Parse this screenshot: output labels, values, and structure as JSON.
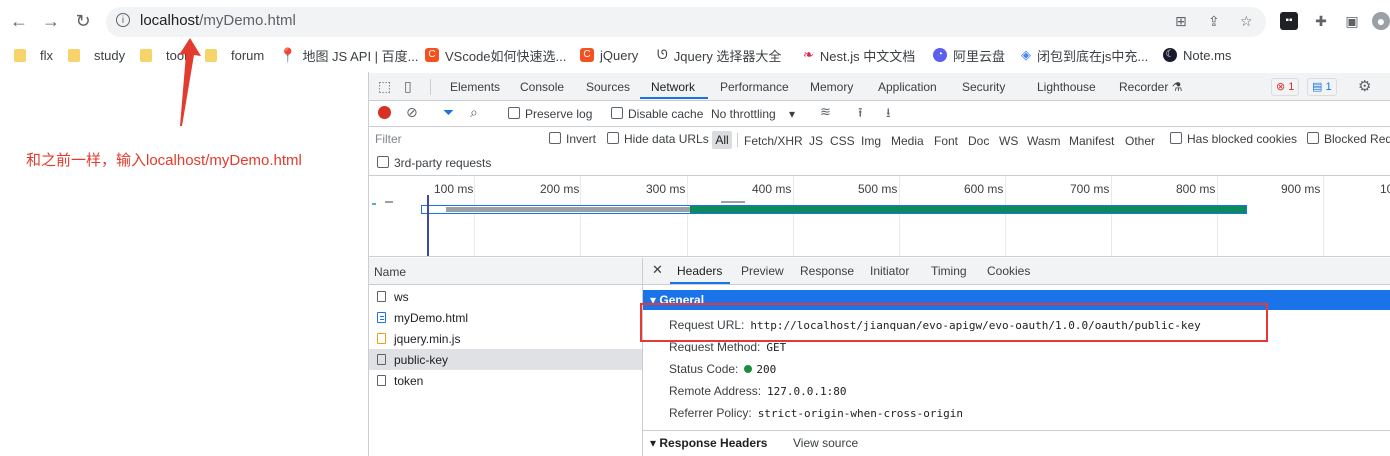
{
  "browser": {
    "url_host": "localhost",
    "url_path": "/myDemo.html"
  },
  "bookmarks": [
    {
      "label": "flx",
      "icon": "folder-icon"
    },
    {
      "label": "study",
      "icon": "folder-icon"
    },
    {
      "label": "tool",
      "icon": "folder-icon"
    },
    {
      "label": "forum",
      "icon": "folder-icon"
    },
    {
      "label": "地图 JS API | 百度...",
      "icon": "map-pin-icon"
    },
    {
      "label": "VScode如何快速选...",
      "icon": "c-icon"
    },
    {
      "label": "jQuery",
      "icon": "c-icon"
    },
    {
      "label": "Jquery 选择器大全",
      "icon": "squiggle-icon"
    },
    {
      "label": "Nest.js 中文文档",
      "icon": "nest-icon"
    },
    {
      "label": "阿里云盘",
      "icon": "cloud-icon"
    },
    {
      "label": "闭包到底在js中充...",
      "icon": "diamond-icon"
    },
    {
      "label": "Note.ms",
      "icon": "moon-icon"
    }
  ],
  "annotation": "和之前一样，输入localhost/myDemo.html",
  "devtools": {
    "tabs": [
      "Elements",
      "Console",
      "Sources",
      "Network",
      "Performance",
      "Memory",
      "Application",
      "Security",
      "Lighthouse",
      "Recorder"
    ],
    "active_tab": "Network",
    "error_count": "1",
    "message_count": "1",
    "toolbar": {
      "preserve_log": "Preserve log",
      "disable_cache": "Disable cache",
      "throttling": "No throttling"
    },
    "filter": {
      "placeholder": "Filter",
      "invert": "Invert",
      "hide_data_urls": "Hide data URLs",
      "types": [
        "All",
        "Fetch/XHR",
        "JS",
        "CSS",
        "Img",
        "Media",
        "Font",
        "Doc",
        "WS",
        "Wasm",
        "Manifest",
        "Other"
      ],
      "blocked_cookies": "Has blocked cookies",
      "blocked_requests": "Blocked Req",
      "third_party": "3rd-party requests"
    },
    "timeline_ticks": [
      "100 ms",
      "200 ms",
      "300 ms",
      "400 ms",
      "500 ms",
      "600 ms",
      "700 ms",
      "800 ms",
      "900 ms",
      "10"
    ],
    "name_header": "Name",
    "requests": [
      {
        "name": "ws",
        "type": "other"
      },
      {
        "name": "myDemo.html",
        "type": "doc"
      },
      {
        "name": "jquery.min.js",
        "type": "js"
      },
      {
        "name": "public-key",
        "type": "other",
        "selected": true
      },
      {
        "name": "token",
        "type": "other"
      }
    ],
    "detail_tabs": [
      "Headers",
      "Preview",
      "Response",
      "Initiator",
      "Timing",
      "Cookies"
    ],
    "active_detail_tab": "Headers",
    "general_title": "General",
    "general": {
      "request_url_label": "Request URL:",
      "request_url": "http://localhost/jianquan/evo-apigw/evo-oauth/1.0.0/oauth/public-key",
      "request_method_label": "Request Method:",
      "request_method": "GET",
      "status_code_label": "Status Code:",
      "status_code": "200",
      "remote_address_label": "Remote Address:",
      "remote_address": "127.0.0.1:80",
      "referrer_policy_label": "Referrer Policy:",
      "referrer_policy": "strict-origin-when-cross-origin"
    },
    "response_headers_title": "Response Headers",
    "view_source": "View source"
  },
  "colors": {
    "accent": "#1a73e8",
    "annotation": "#e33b2e",
    "status_ok": "#1e8e3e",
    "highlight_box": "#e53935"
  }
}
